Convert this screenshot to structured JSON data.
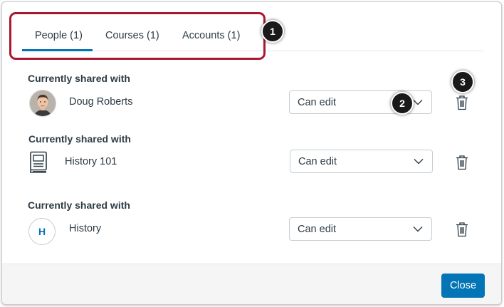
{
  "tabs": [
    {
      "label": "People (1)"
    },
    {
      "label": "Courses (1)"
    },
    {
      "label": "Accounts (1)"
    }
  ],
  "callouts": [
    "1",
    "2",
    "3"
  ],
  "shares": [
    {
      "heading": "Currently shared with",
      "name": "Doug Roberts",
      "permission": "Can edit",
      "avatar_type": "photo"
    },
    {
      "heading": "Currently shared with",
      "name": "History 101",
      "permission": "Can edit",
      "avatar_type": "course-icon"
    },
    {
      "heading": "Currently shared with",
      "name": "History",
      "permission": "Can edit",
      "avatar_type": "letter",
      "avatar_letter": "H"
    }
  ],
  "footer": {
    "close_label": "Close"
  },
  "colors": {
    "accent": "#0374b5",
    "highlight": "#a8192f",
    "callout": "#1a1a1a"
  }
}
